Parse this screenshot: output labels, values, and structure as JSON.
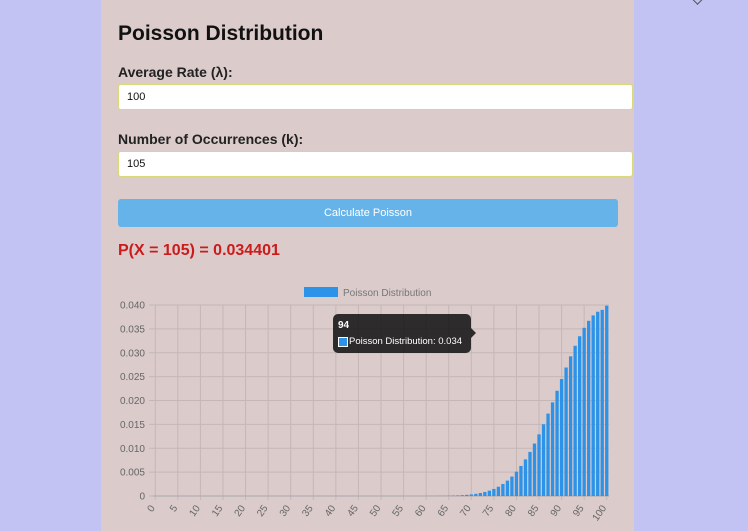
{
  "form": {
    "title": "Poisson Distribution",
    "rate_label": "Average Rate (λ):",
    "rate_value": "100",
    "k_label": "Number of Occurrences (k):",
    "k_value": "105",
    "button_label": "Calculate Poisson"
  },
  "result": {
    "text": "P(X = 105) = 0.034401"
  },
  "tooltip": {
    "title": "94",
    "text": "Poisson Distribution: 0.034"
  },
  "colors": {
    "bar": "#2c93e8",
    "result": "#cc1b1b",
    "button": "#66b3e9"
  },
  "chart_data": {
    "type": "bar",
    "lambda": 100,
    "x": [
      0,
      1,
      2,
      3,
      4,
      5,
      6,
      7,
      8,
      9,
      10,
      11,
      12,
      13,
      14,
      15,
      16,
      17,
      18,
      19,
      20,
      21,
      22,
      23,
      24,
      25,
      26,
      27,
      28,
      29,
      30,
      31,
      32,
      33,
      34,
      35,
      36,
      37,
      38,
      39,
      40,
      41,
      42,
      43,
      44,
      45,
      46,
      47,
      48,
      49,
      50,
      51,
      52,
      53,
      54,
      55,
      56,
      57,
      58,
      59,
      60,
      61,
      62,
      63,
      64,
      65,
      66,
      67,
      68,
      69,
      70,
      71,
      72,
      73,
      74,
      75,
      76,
      77,
      78,
      79,
      80,
      81,
      82,
      83,
      84,
      85,
      86,
      87,
      88,
      89,
      90,
      91,
      92,
      93,
      94,
      95,
      96,
      97,
      98,
      99,
      100
    ],
    "series": [
      {
        "name": "Poisson Distribution",
        "values": [
          0,
          0,
          0,
          0,
          0,
          0,
          0,
          0,
          0,
          0,
          0,
          0,
          0,
          0,
          0,
          0,
          0,
          0,
          0,
          0,
          0,
          0,
          0,
          0,
          0,
          0,
          0,
          0,
          0,
          0,
          0,
          0,
          0,
          0,
          0,
          0,
          0,
          0,
          0,
          0,
          0,
          0,
          0,
          0,
          0,
          0,
          0,
          0,
          0,
          0,
          0,
          0,
          0,
          0,
          0,
          0,
          0,
          0,
          0,
          0,
          1e-05,
          2e-05,
          2e-05,
          3e-05,
          4e-05,
          6e-05,
          9e-05,
          0.00012,
          0.00017,
          0.00024,
          0.00033,
          0.00045,
          0.00062,
          0.00084,
          0.00111,
          0.00148,
          0.00194,
          0.00252,
          0.00322,
          0.00407,
          0.00509,
          0.00629,
          0.00767,
          0.00923,
          0.01098,
          0.01291,
          0.01502,
          0.01726,
          0.01961,
          0.02204,
          0.02449,
          0.02691,
          0.02925,
          0.03146,
          0.03346,
          0.03522,
          0.03669,
          0.03782,
          0.03859,
          0.03898,
          0.03986
        ]
      }
    ],
    "ylim": [
      0,
      0.04
    ],
    "yticks": [
      "0",
      "0.005",
      "0.010",
      "0.015",
      "0.020",
      "0.025",
      "0.030",
      "0.035",
      "0.040"
    ],
    "xticks": [
      "0",
      "5",
      "10",
      "15",
      "20",
      "25",
      "30",
      "35",
      "40",
      "45",
      "50",
      "55",
      "60",
      "65",
      "70",
      "75",
      "80",
      "85",
      "90",
      "95",
      "100"
    ],
    "legend": "top-center",
    "grid": true
  }
}
